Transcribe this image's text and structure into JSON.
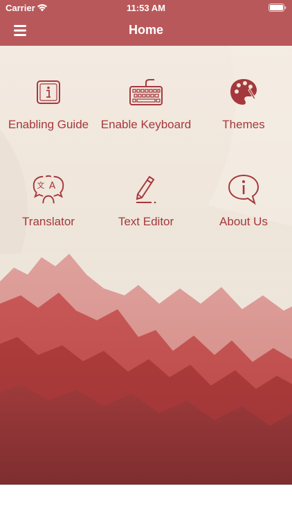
{
  "status_bar": {
    "carrier": "Carrier",
    "time": "11:53 AM"
  },
  "nav": {
    "title": "Home",
    "menu_icon": "hamburger-menu-icon"
  },
  "tiles": [
    {
      "label": "Enabling Guide",
      "icon": "info-icon"
    },
    {
      "label": "Enable Keyboard",
      "icon": "keyboard-icon"
    },
    {
      "label": "Themes",
      "icon": "palette-icon"
    },
    {
      "label": "Translator",
      "icon": "translate-icon"
    },
    {
      "label": "Text Editor",
      "icon": "pencil-edit-icon"
    },
    {
      "label": "About Us",
      "icon": "info-bubble-icon"
    }
  ],
  "colors": {
    "header": "#b9585a",
    "accent": "#a5383c",
    "background": "#efe8de",
    "mountains": "#b54244"
  }
}
